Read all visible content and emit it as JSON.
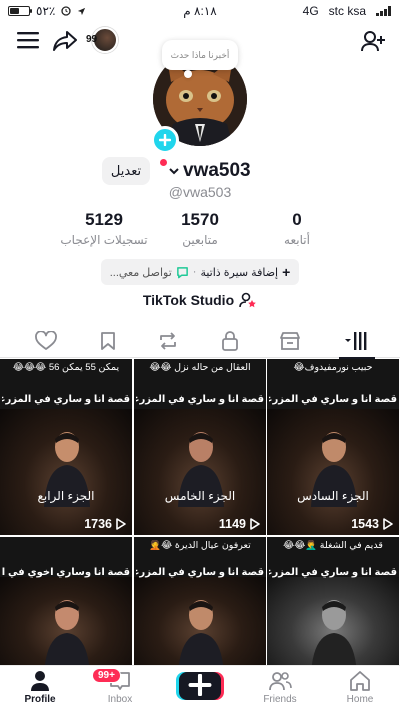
{
  "status_bar": {
    "battery_percent": "٥٢٪",
    "time": "٨:١٨ م",
    "network": "4G",
    "carrier": "stc ksa",
    "battery_level": 0.52
  },
  "top_bar": {
    "story_count": "99",
    "icons": [
      "menu-icon",
      "share-icon",
      "add-user-icon"
    ]
  },
  "note_bubble": {
    "text": "أخبرنا ماذا حدث"
  },
  "profile": {
    "edit_label": "تعديل",
    "username": "vwa503",
    "handle": "@vwa503"
  },
  "stats": {
    "likes": {
      "value": "5129",
      "label": "تسجيلات الإعجاب"
    },
    "followers": {
      "value": "1570",
      "label": "متابعين"
    },
    "following": {
      "value": "0",
      "label": "أتابعه"
    }
  },
  "bio_chip": {
    "add_bio": "إضافة سيرة ذاتية",
    "contact": "تواصل معي..."
  },
  "studio": {
    "label": "TikTok Studio"
  },
  "tabs": [
    "videos-grid",
    "shop",
    "private",
    "reposts",
    "saved",
    "liked"
  ],
  "videos": [
    {
      "top_caption": "حبيب نورمفيدوف😂",
      "main_caption": "قصة انا و ساري في المزرعة 😂😂",
      "part": "الجزء السادس",
      "views": "1543"
    },
    {
      "top_caption": "العقال من حاله نزل 😂😂",
      "main_caption": "قصة انا و ساري في المزرعة 😂😂",
      "part": "الجزء الخامس",
      "views": "1149"
    },
    {
      "top_caption": "يمكن 55 يمكن 56 😂😂😂",
      "main_caption": "قصة انا و ساري في المزرعة 😂😂",
      "part": "الجزء الرابع",
      "views": "1736"
    },
    {
      "top_caption": "قديم في الشغلة 🤦‍♂️😂😂",
      "main_caption": "قصة انا و ساري في المزرعة 😂😂",
      "part": "",
      "views": ""
    },
    {
      "top_caption": "تعرفون عيال الديرة 😂🤦",
      "main_caption": "قصة انا و ساري في المزرعة 😂",
      "part": "",
      "views": ""
    },
    {
      "top_caption": "",
      "main_caption": "قصة انا وساري اخوي في المزرعه 😂",
      "part": "",
      "views": ""
    }
  ],
  "bottom_nav": {
    "profile": "Profile",
    "inbox": "Inbox",
    "inbox_badge": "99+",
    "friends": "Friends",
    "home": "Home"
  },
  "colors": {
    "accent_red": "#fe2c55",
    "accent_cyan": "#20d5ec",
    "text": "#161823",
    "muted": "#8a8b91"
  }
}
